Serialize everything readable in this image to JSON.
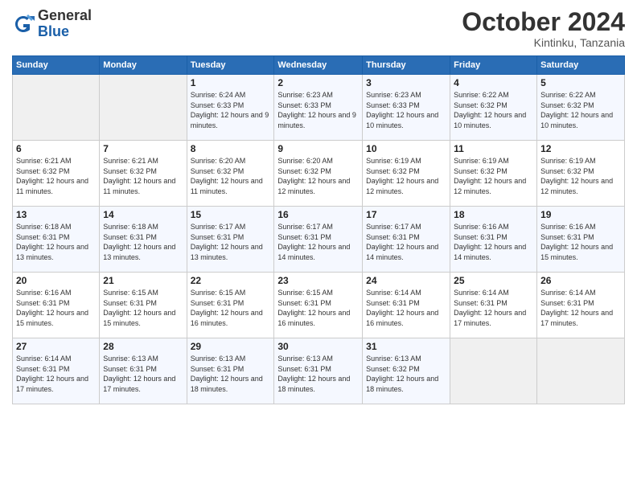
{
  "header": {
    "logo_general": "General",
    "logo_blue": "Blue",
    "month_title": "October 2024",
    "location": "Kintinku, Tanzania"
  },
  "weekdays": [
    "Sunday",
    "Monday",
    "Tuesday",
    "Wednesday",
    "Thursday",
    "Friday",
    "Saturday"
  ],
  "weeks": [
    [
      {
        "day": "",
        "info": ""
      },
      {
        "day": "",
        "info": ""
      },
      {
        "day": "1",
        "info": "Sunrise: 6:24 AM\nSunset: 6:33 PM\nDaylight: 12 hours and 9 minutes."
      },
      {
        "day": "2",
        "info": "Sunrise: 6:23 AM\nSunset: 6:33 PM\nDaylight: 12 hours and 9 minutes."
      },
      {
        "day": "3",
        "info": "Sunrise: 6:23 AM\nSunset: 6:33 PM\nDaylight: 12 hours and 10 minutes."
      },
      {
        "day": "4",
        "info": "Sunrise: 6:22 AM\nSunset: 6:32 PM\nDaylight: 12 hours and 10 minutes."
      },
      {
        "day": "5",
        "info": "Sunrise: 6:22 AM\nSunset: 6:32 PM\nDaylight: 12 hours and 10 minutes."
      }
    ],
    [
      {
        "day": "6",
        "info": "Sunrise: 6:21 AM\nSunset: 6:32 PM\nDaylight: 12 hours and 11 minutes."
      },
      {
        "day": "7",
        "info": "Sunrise: 6:21 AM\nSunset: 6:32 PM\nDaylight: 12 hours and 11 minutes."
      },
      {
        "day": "8",
        "info": "Sunrise: 6:20 AM\nSunset: 6:32 PM\nDaylight: 12 hours and 11 minutes."
      },
      {
        "day": "9",
        "info": "Sunrise: 6:20 AM\nSunset: 6:32 PM\nDaylight: 12 hours and 12 minutes."
      },
      {
        "day": "10",
        "info": "Sunrise: 6:19 AM\nSunset: 6:32 PM\nDaylight: 12 hours and 12 minutes."
      },
      {
        "day": "11",
        "info": "Sunrise: 6:19 AM\nSunset: 6:32 PM\nDaylight: 12 hours and 12 minutes."
      },
      {
        "day": "12",
        "info": "Sunrise: 6:19 AM\nSunset: 6:32 PM\nDaylight: 12 hours and 12 minutes."
      }
    ],
    [
      {
        "day": "13",
        "info": "Sunrise: 6:18 AM\nSunset: 6:31 PM\nDaylight: 12 hours and 13 minutes."
      },
      {
        "day": "14",
        "info": "Sunrise: 6:18 AM\nSunset: 6:31 PM\nDaylight: 12 hours and 13 minutes."
      },
      {
        "day": "15",
        "info": "Sunrise: 6:17 AM\nSunset: 6:31 PM\nDaylight: 12 hours and 13 minutes."
      },
      {
        "day": "16",
        "info": "Sunrise: 6:17 AM\nSunset: 6:31 PM\nDaylight: 12 hours and 14 minutes."
      },
      {
        "day": "17",
        "info": "Sunrise: 6:17 AM\nSunset: 6:31 PM\nDaylight: 12 hours and 14 minutes."
      },
      {
        "day": "18",
        "info": "Sunrise: 6:16 AM\nSunset: 6:31 PM\nDaylight: 12 hours and 14 minutes."
      },
      {
        "day": "19",
        "info": "Sunrise: 6:16 AM\nSunset: 6:31 PM\nDaylight: 12 hours and 15 minutes."
      }
    ],
    [
      {
        "day": "20",
        "info": "Sunrise: 6:16 AM\nSunset: 6:31 PM\nDaylight: 12 hours and 15 minutes."
      },
      {
        "day": "21",
        "info": "Sunrise: 6:15 AM\nSunset: 6:31 PM\nDaylight: 12 hours and 15 minutes."
      },
      {
        "day": "22",
        "info": "Sunrise: 6:15 AM\nSunset: 6:31 PM\nDaylight: 12 hours and 16 minutes."
      },
      {
        "day": "23",
        "info": "Sunrise: 6:15 AM\nSunset: 6:31 PM\nDaylight: 12 hours and 16 minutes."
      },
      {
        "day": "24",
        "info": "Sunrise: 6:14 AM\nSunset: 6:31 PM\nDaylight: 12 hours and 16 minutes."
      },
      {
        "day": "25",
        "info": "Sunrise: 6:14 AM\nSunset: 6:31 PM\nDaylight: 12 hours and 17 minutes."
      },
      {
        "day": "26",
        "info": "Sunrise: 6:14 AM\nSunset: 6:31 PM\nDaylight: 12 hours and 17 minutes."
      }
    ],
    [
      {
        "day": "27",
        "info": "Sunrise: 6:14 AM\nSunset: 6:31 PM\nDaylight: 12 hours and 17 minutes."
      },
      {
        "day": "28",
        "info": "Sunrise: 6:13 AM\nSunset: 6:31 PM\nDaylight: 12 hours and 17 minutes."
      },
      {
        "day": "29",
        "info": "Sunrise: 6:13 AM\nSunset: 6:31 PM\nDaylight: 12 hours and 18 minutes."
      },
      {
        "day": "30",
        "info": "Sunrise: 6:13 AM\nSunset: 6:31 PM\nDaylight: 12 hours and 18 minutes."
      },
      {
        "day": "31",
        "info": "Sunrise: 6:13 AM\nSunset: 6:32 PM\nDaylight: 12 hours and 18 minutes."
      },
      {
        "day": "",
        "info": ""
      },
      {
        "day": "",
        "info": ""
      }
    ]
  ]
}
